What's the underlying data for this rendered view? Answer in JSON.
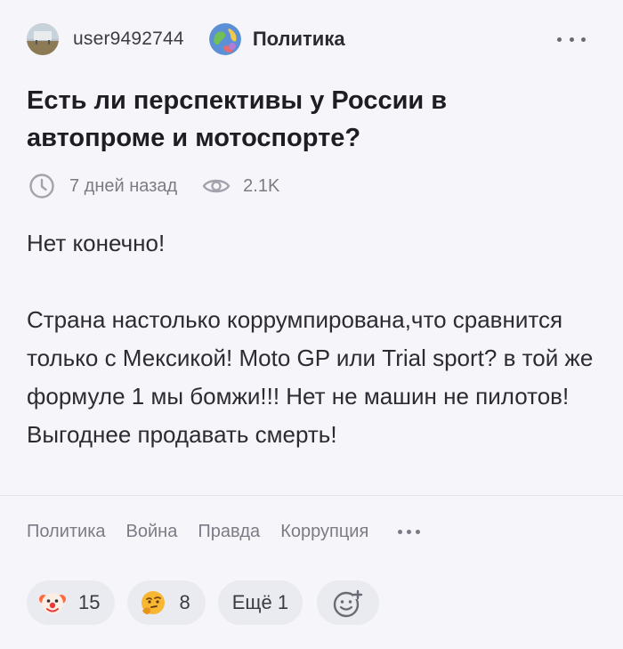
{
  "post": {
    "author": "user9492744",
    "community": "Политика",
    "title": "Есть ли перспективы у России в автопроме и мотоспорте?",
    "time": "7 дней назад",
    "views": "2.1K",
    "body": [
      "Нет конечно!",
      "Страна настолько коррумпирована,что сравнится только с Мексикой! Moto GP или Trial sport? в той же формуле 1 мы бомжи!!! Нет не машин не пилотов! Выгоднее продавать смерть!"
    ],
    "tags": [
      "Политика",
      "Война",
      "Правда",
      "Коррупция"
    ]
  },
  "reactions": [
    {
      "icon": "clown-face-icon",
      "count": "15"
    },
    {
      "icon": "thinking-face-icon",
      "count": "8"
    }
  ],
  "reactions_more": "Ещё 1",
  "icons": {
    "more": "more-horizontal-icon",
    "clock": "clock-icon",
    "eye": "eye-icon",
    "add_reaction": "add-reaction-icon"
  },
  "colors": {
    "background": "#f6f6fa",
    "pill": "#eaeaf1",
    "muted": "#7b7b85"
  }
}
